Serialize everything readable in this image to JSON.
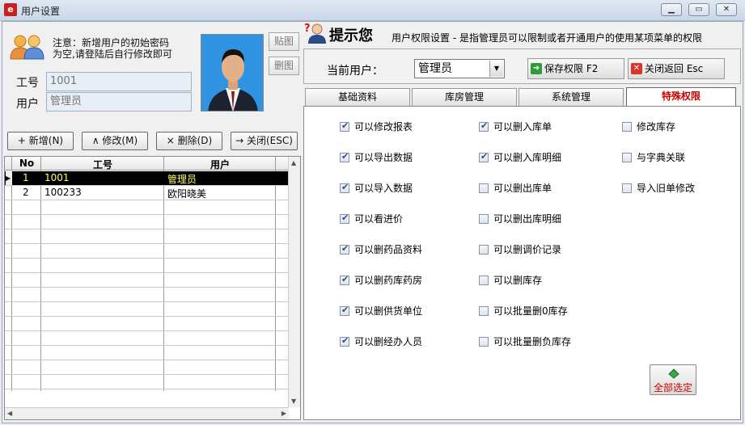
{
  "window": {
    "title": "用户设置"
  },
  "left": {
    "note_line1": "注意：新增用户的初始密码",
    "note_line2": "为空,请登陆后自行修改即可",
    "paste_image": "贴图",
    "delete_image": "删图",
    "employee_id_label": "工号",
    "employee_id_value": "1001",
    "user_label": "用户",
    "user_value": "管理员",
    "buttons": {
      "add": "+ 新增(N)",
      "edit": "∧ 修改(M)",
      "delete": "× 删除(D)",
      "close": "→ 关闭(ESC)"
    },
    "grid": {
      "headers": [
        "No",
        "工号",
        "用户"
      ],
      "rows": [
        {
          "no": "1",
          "id": "1001",
          "user": "管理员"
        },
        {
          "no": "2",
          "id": "100233",
          "user": "欧阳晓美"
        }
      ]
    }
  },
  "right": {
    "tip_title": "提示您",
    "description": "用户权限设置 - 是指管理员可以限制或者开通用户的使用某项菜单的权限",
    "current_user_label": "当前用户：",
    "current_user_value": "管理员",
    "save_button": "保存权限 F2",
    "close_button": "关闭返回 Esc",
    "tabs": [
      "基础资料",
      "库房管理",
      "系统管理",
      "特殊权限"
    ],
    "active_tab": "特殊权限",
    "permissions": [
      [
        {
          "label": "可以修改报表",
          "checked": true
        },
        {
          "label": "可以导出数据",
          "checked": true
        },
        {
          "label": "可以导入数据",
          "checked": true
        },
        {
          "label": "可以看进价",
          "checked": true
        },
        {
          "label": "可以删药品资料",
          "checked": true
        },
        {
          "label": "可以删药库药房",
          "checked": true
        },
        {
          "label": "可以删供货单位",
          "checked": true
        },
        {
          "label": "可以删经办人员",
          "checked": true
        }
      ],
      [
        {
          "label": "可以删入库单",
          "checked": true
        },
        {
          "label": "可以删入库明细",
          "checked": true
        },
        {
          "label": "可以删出库单",
          "checked": false
        },
        {
          "label": "可以删出库明细",
          "checked": false
        },
        {
          "label": "可以删调价记录",
          "checked": false
        },
        {
          "label": "可以删库存",
          "checked": false
        },
        {
          "label": "可以批量删0库存",
          "checked": false
        },
        {
          "label": "可以批量删负库存",
          "checked": false
        }
      ],
      [
        {
          "label": "修改库存",
          "checked": false
        },
        {
          "label": "与字典关联",
          "checked": false
        },
        {
          "label": "导入旧单修改",
          "checked": false
        }
      ]
    ],
    "select_all": "全部选定"
  }
}
